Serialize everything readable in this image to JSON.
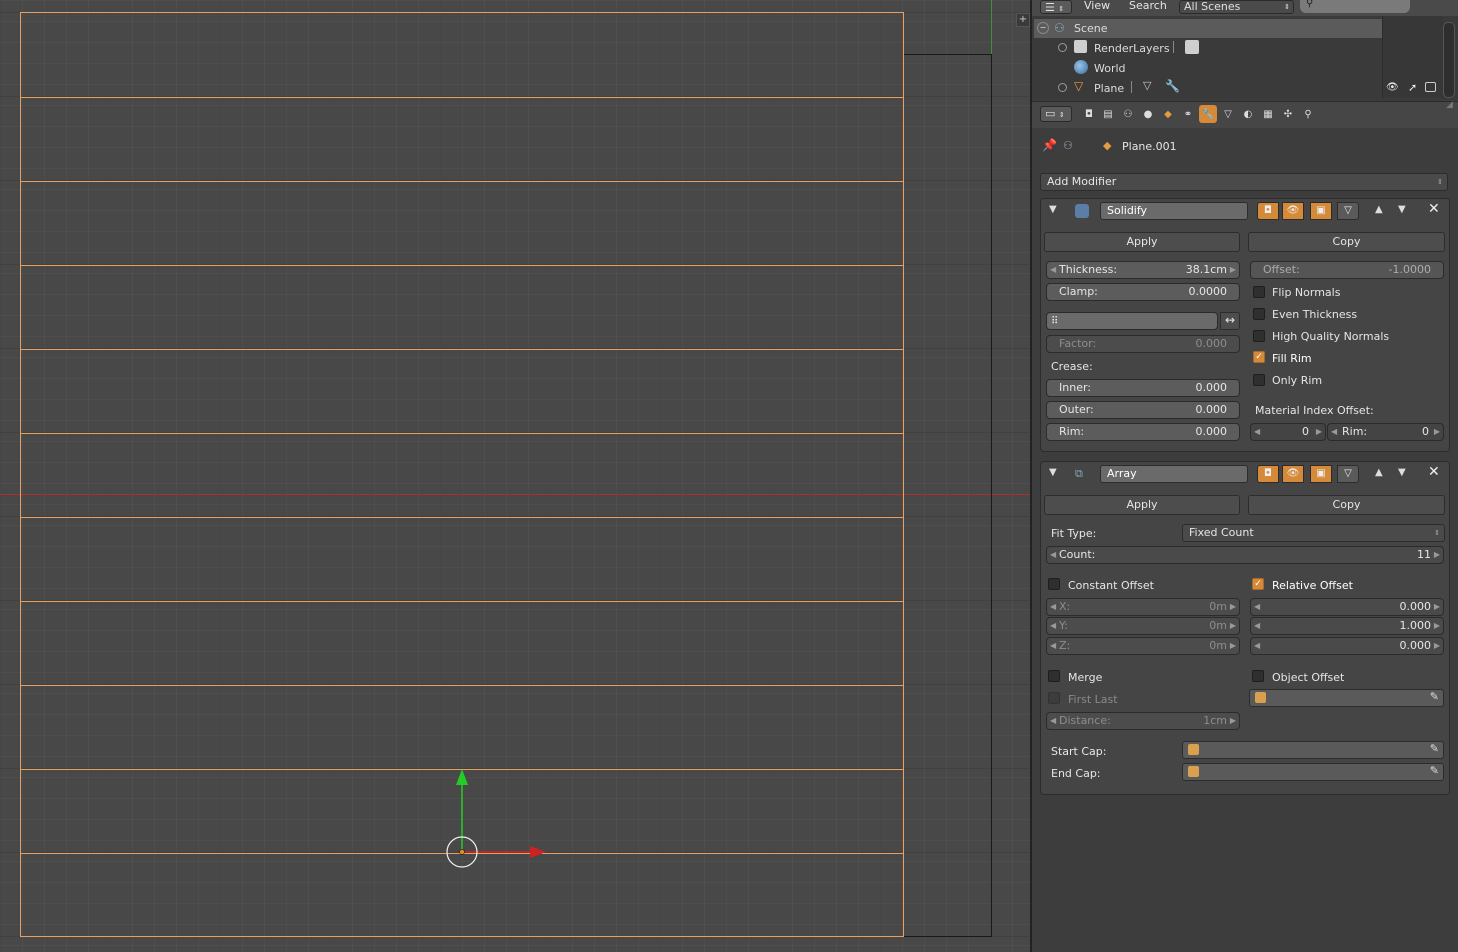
{
  "colors": {
    "accent": "#d58a3a",
    "selection_edge": "#e8a060",
    "x_axis": "#cc2222",
    "y_axis": "#22cc22"
  },
  "outliner": {
    "menu": {
      "view": "View",
      "search": "Search",
      "scenes": "All Scenes"
    },
    "tree": [
      {
        "label": "Scene",
        "icon": "scene-icon"
      },
      {
        "label": "RenderLayers",
        "icon": "render-layers-icon"
      },
      {
        "label": "World",
        "icon": "world-icon"
      },
      {
        "label": "Plane",
        "icon": "mesh-object-icon"
      }
    ]
  },
  "properties": {
    "context": {
      "object_name": "Plane.001"
    },
    "add_modifier": "Add Modifier",
    "solidify": {
      "name": "Solidify",
      "apply": "Apply",
      "copy": "Copy",
      "thickness_label": "Thickness:",
      "thickness_value": "38.1cm",
      "offset_label": "Offset:",
      "offset_value": "-1.0000",
      "clamp_label": "Clamp:",
      "clamp_value": "0.0000",
      "factor_label": "Factor:",
      "factor_value": "0.000",
      "crease_label": "Crease:",
      "inner_label": "Inner:",
      "inner_value": "0.000",
      "outer_label": "Outer:",
      "outer_value": "0.000",
      "rim_label": "Rim:",
      "rim_value": "0.000",
      "flip_normals": "Flip Normals",
      "even_thickness": "Even Thickness",
      "high_quality_normals": "High Quality Normals",
      "fill_rim": "Fill Rim",
      "only_rim": "Only Rim",
      "material_index_offset": "Material Index Offset:",
      "mat_offset_value": "0",
      "mat_rim_label": "Rim:",
      "mat_rim_value": "0"
    },
    "array": {
      "name": "Array",
      "apply": "Apply",
      "copy": "Copy",
      "fit_type_label": "Fit Type:",
      "fit_type_value": "Fixed Count",
      "count_label": "Count:",
      "count_value": "11",
      "constant_offset": "Constant Offset",
      "relative_offset": "Relative Offset",
      "const_x_label": "X:",
      "const_x_value": "0m",
      "const_y_label": "Y:",
      "const_y_value": "0m",
      "const_z_label": "Z:",
      "const_z_value": "0m",
      "rel_x_value": "0.000",
      "rel_y_value": "1.000",
      "rel_z_value": "0.000",
      "merge": "Merge",
      "first_last": "First Last",
      "object_offset": "Object Offset",
      "distance_label": "Distance:",
      "distance_value": "1cm",
      "start_cap_label": "Start Cap:",
      "end_cap_label": "End Cap:"
    }
  }
}
